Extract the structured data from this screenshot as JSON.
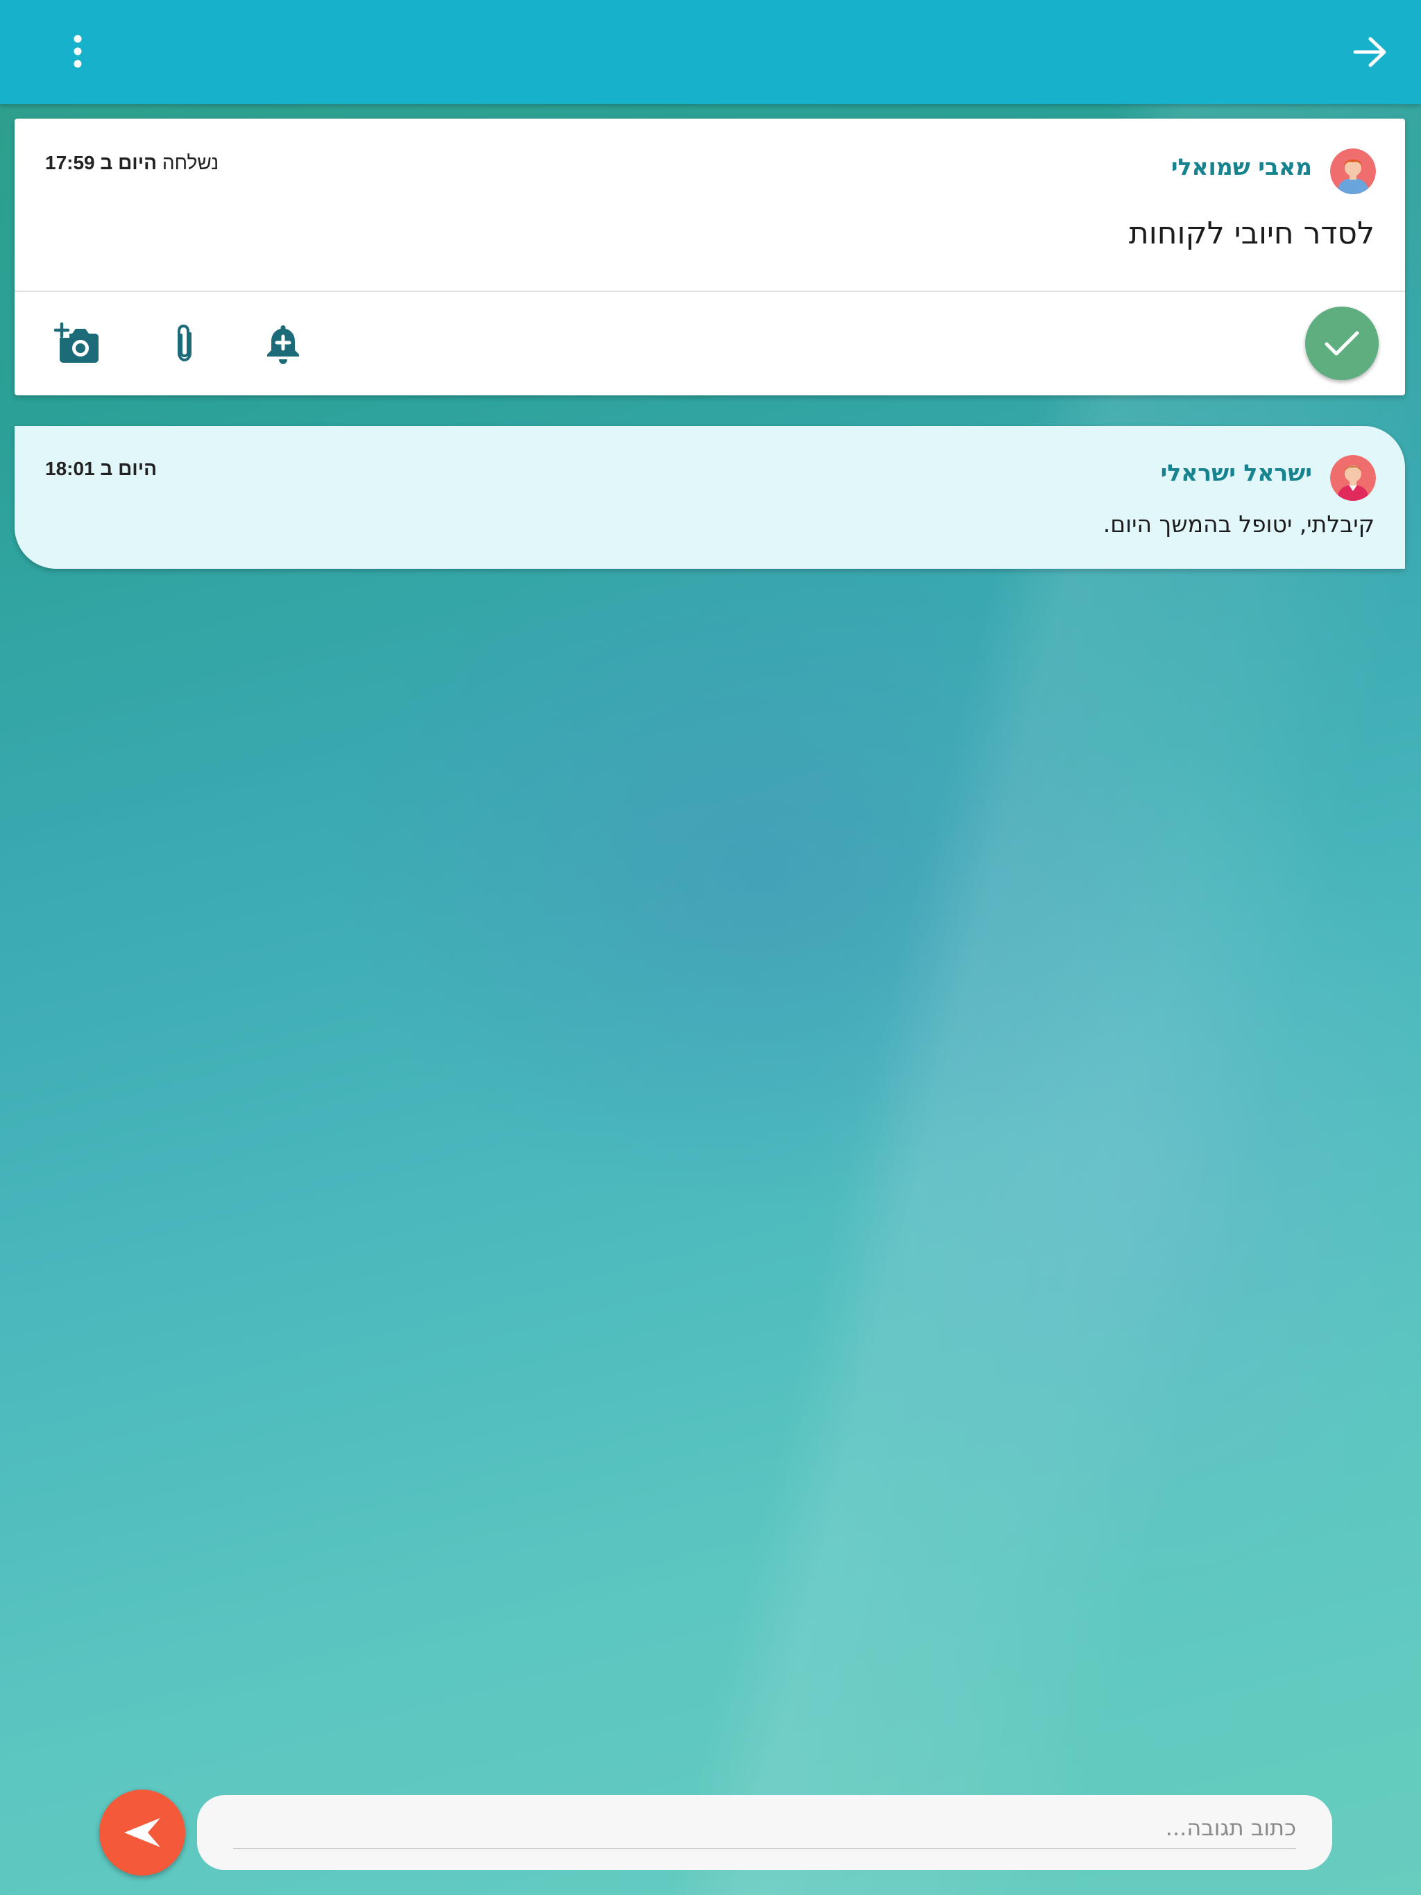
{
  "header": {
    "menu_icon": "more-vert-icon",
    "back_icon": "arrow-forward-icon",
    "color": "#17b1cb"
  },
  "task": {
    "author": "מאבי שמואלי",
    "sent_label": "נשלחה",
    "time_label": "היום ב 17:59",
    "title": "לסדר חיובי לקוחות",
    "actions": {
      "done_icon": "check-icon",
      "reminder_icon": "add-alert-icon",
      "attach_icon": "paperclip-icon",
      "camera_icon": "add-photo-icon"
    }
  },
  "reply": {
    "author": "ישראל ישראלי",
    "time_label": "היום ב 18:01",
    "text": "קיבלתי, יטופל בהמשך היום."
  },
  "composer": {
    "placeholder": "כתוב תגובה...",
    "value": "",
    "send_icon": "send-icon"
  },
  "colors": {
    "accent_teal": "#16838f",
    "done_green": "#5fae7f",
    "send_orange": "#f4593a",
    "icon_teal": "#1b6b78",
    "reply_bubble": "#e2f7fa"
  }
}
